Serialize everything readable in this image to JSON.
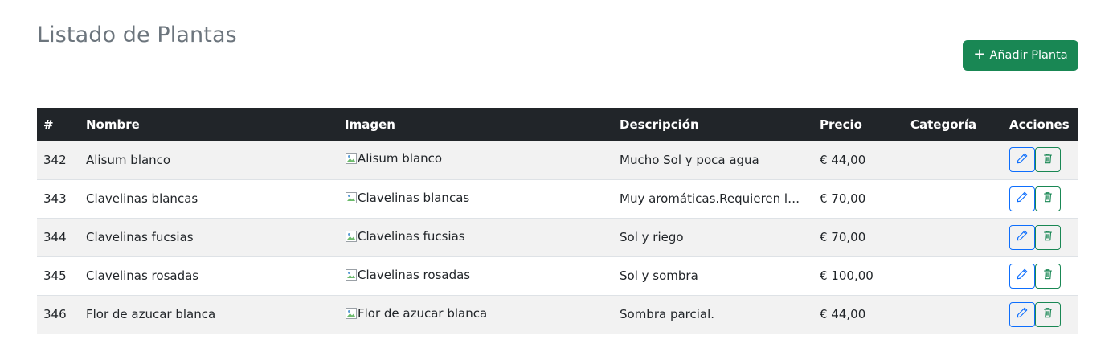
{
  "header": {
    "title": "Listado de Plantas",
    "add_button_label": "Añadir Planta",
    "add_icon": "plus-icon"
  },
  "table": {
    "columns": [
      "#",
      "Nombre",
      "Imagen",
      "Descripción",
      "Precio",
      "Categoría",
      "Acciones"
    ],
    "rows": [
      {
        "id": "342",
        "nombre": "Alisum blanco",
        "imagen_alt": "Alisum blanco",
        "descripcion": "Mucho Sol y poca agua",
        "precio": "€ 44,00",
        "categoria": ""
      },
      {
        "id": "343",
        "nombre": "Clavelinas blancas",
        "imagen_alt": "Clavelinas blancas",
        "descripcion": "Muy aromáticas.Requieren lu…",
        "precio": "€ 70,00",
        "categoria": ""
      },
      {
        "id": "344",
        "nombre": "Clavelinas fucsias",
        "imagen_alt": "Clavelinas fucsias",
        "descripcion": "Sol y riego",
        "precio": "€ 70,00",
        "categoria": ""
      },
      {
        "id": "345",
        "nombre": "Clavelinas rosadas",
        "imagen_alt": "Clavelinas rosadas",
        "descripcion": "Sol y sombra",
        "precio": "€ 100,00",
        "categoria": ""
      },
      {
        "id": "346",
        "nombre": "Flor de azucar blanca",
        "imagen_alt": "Flor de azucar blanca",
        "descripcion": "Sombra parcial.",
        "precio": "€ 44,00",
        "categoria": ""
      }
    ],
    "row_actions": {
      "edit_icon": "pencil-icon",
      "delete_icon": "trash-icon"
    }
  },
  "colors": {
    "header_bg": "#212529",
    "title": "#6c757d",
    "add_button": "#198754",
    "edit_outline": "#0d6efd",
    "delete_outline": "#198754",
    "row_striped": "#f2f2f2"
  }
}
